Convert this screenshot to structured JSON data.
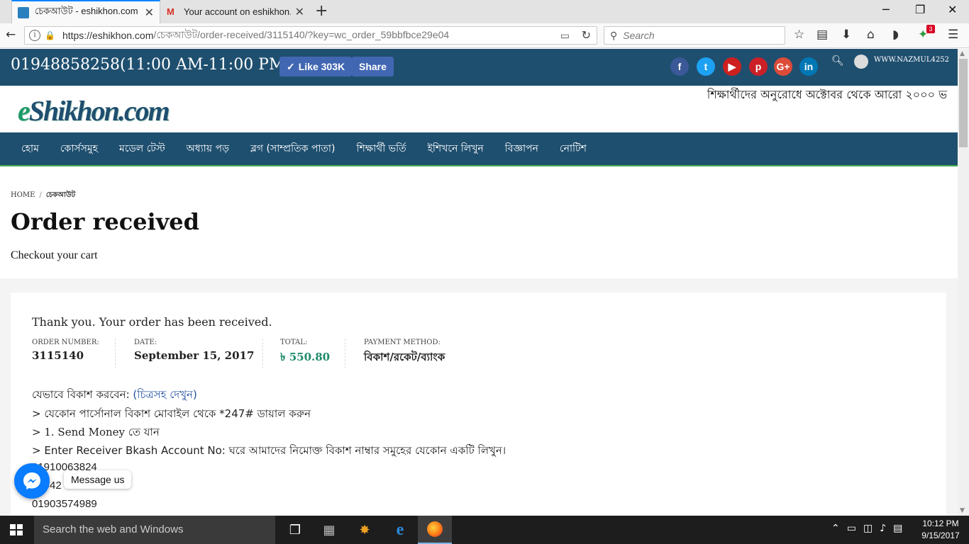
{
  "browser": {
    "tabs": [
      {
        "title": "চেকআউট - eshikhon.com -",
        "active": true
      },
      {
        "title": "Your account on eshikhon.c",
        "active": false
      }
    ],
    "url_host": "https://eshikhon.com",
    "url_path": "/চেকআউট/order-received/3115140/?key=wc_order_59bbfbce29e04",
    "search_placeholder": "Search",
    "badge_count": "3"
  },
  "topbar": {
    "phone": "01948858258(11:00 AM-11:00 PM)",
    "like_label": "Like 303K",
    "share_label": "Share",
    "username": "WWW.NAZMUL4252",
    "social": [
      "facebook",
      "twitter",
      "youtube",
      "pinterest",
      "google-plus",
      "linkedin"
    ],
    "social_glyphs": [
      "f",
      "t",
      "▶",
      "p",
      "G+",
      "in"
    ],
    "social_colors": [
      "#3b5998",
      "#1da1f2",
      "#cd201f",
      "#cb2027",
      "#dd4b39",
      "#0077b5"
    ]
  },
  "header": {
    "logo_e": "e",
    "logo_rest": "Shikhon.com",
    "marquee": "শিক্ষার্থীদের অনুরোধে অক্টোবর থেকে আরো ২০০০ ভ"
  },
  "nav": {
    "items": [
      "হোম",
      "কোর্সসমুহ",
      "মডেল টেস্ট",
      "অধ্যায় পড়",
      "ব্লগ (সাম্প্রতিক পাতা)",
      "শিক্ষার্থী ভর্তি",
      "ইশিখনে লিখুন",
      "বিজ্ঞাপন",
      "নোটিশ"
    ]
  },
  "breadcrumb": {
    "home": "HOME",
    "separator": "/",
    "current": "চেকআউট"
  },
  "page": {
    "title": "Order received",
    "subtitle": "Checkout your cart"
  },
  "order": {
    "thanks": "Thank you. Your order has been received.",
    "order_number_label": "ORDER NUMBER:",
    "order_number": "3115140",
    "date_label": "DATE:",
    "date": "September 15, 2017",
    "total_label": "TOTAL:",
    "total": "৳ 550.80",
    "payment_label": "PAYMENT METHOD:",
    "payment": "বিকাশ/রকেট/ব্যাংক",
    "accent_color": "#1e8a6a"
  },
  "instructions": {
    "line1_prefix": "যেভাবে বিকাশ করবেন: ",
    "line1_link": "(চিত্রসহ দেখুন)",
    "line2": "> যেকোন পার্সোনাল বিকাশ মোবাইল থেকে *247# ডায়াল করুন",
    "line3": "> 1. Send Money তে যান",
    "line4": "> Enter Receiver Bkash Account No: ঘরে আমাদের নিমোক্ত বিকাশ নাম্বার সমুহের যেকোন একটি লিখুন।",
    "number1": "01910063824",
    "number2": "01942",
    "number3": "01903574989"
  },
  "messenger": {
    "label": "Message us"
  },
  "taskbar": {
    "search": "Search the web and Windows",
    "time": "10:12 PM",
    "date": "9/15/2017"
  }
}
